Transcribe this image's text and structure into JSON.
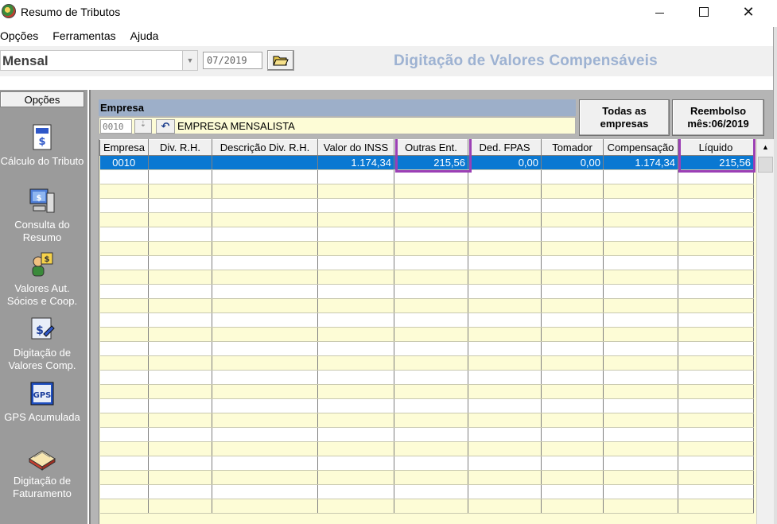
{
  "window": {
    "title": "Resumo de Tributos"
  },
  "menu": [
    "Opções",
    "Ferramentas",
    "Ajuda"
  ],
  "toolbar": {
    "period_value": "Mensal",
    "date_value": "07/2019",
    "heading": "Digitação de Valores Compensáveis"
  },
  "sidebar": {
    "header": "Opções",
    "items": [
      {
        "label": "Cálculo do Tributo",
        "icon": "calculator-icon"
      },
      {
        "label": "Consulta do Resumo",
        "icon": "computer-query-icon"
      },
      {
        "label": "Valores Aut. Sócios e Coop.",
        "icon": "people-money-icon"
      },
      {
        "label": "Digitação de Valores Comp.",
        "icon": "edit-document-icon"
      },
      {
        "label": "GPS Acumulada",
        "icon": "gps-icon"
      },
      {
        "label": "Digitação de Faturamento",
        "icon": "book-icon"
      }
    ]
  },
  "empresa": {
    "label": "Empresa",
    "code": "0010",
    "name": "EMPRESA MENSALISTA"
  },
  "buttons": {
    "todas": "Todas as empresas",
    "reembolso": "Reembolso mês:06/2019"
  },
  "grid": {
    "columns": [
      "Empresa",
      "Div. R.H.",
      "Descrição Div. R.H.",
      "Valor do INSS",
      "Outras Ent.",
      "Ded. FPAS",
      "Tomador",
      "Compensação",
      "Líquido"
    ],
    "rows": [
      [
        "0010",
        "",
        "",
        "1.174,34",
        "215,56",
        "0,00",
        "0,00",
        "1.174,34",
        "215,56"
      ]
    ]
  },
  "colors": {
    "selection": "#0a78d2",
    "highlight": "#9b3fb5",
    "heading": "#9db2d2"
  }
}
